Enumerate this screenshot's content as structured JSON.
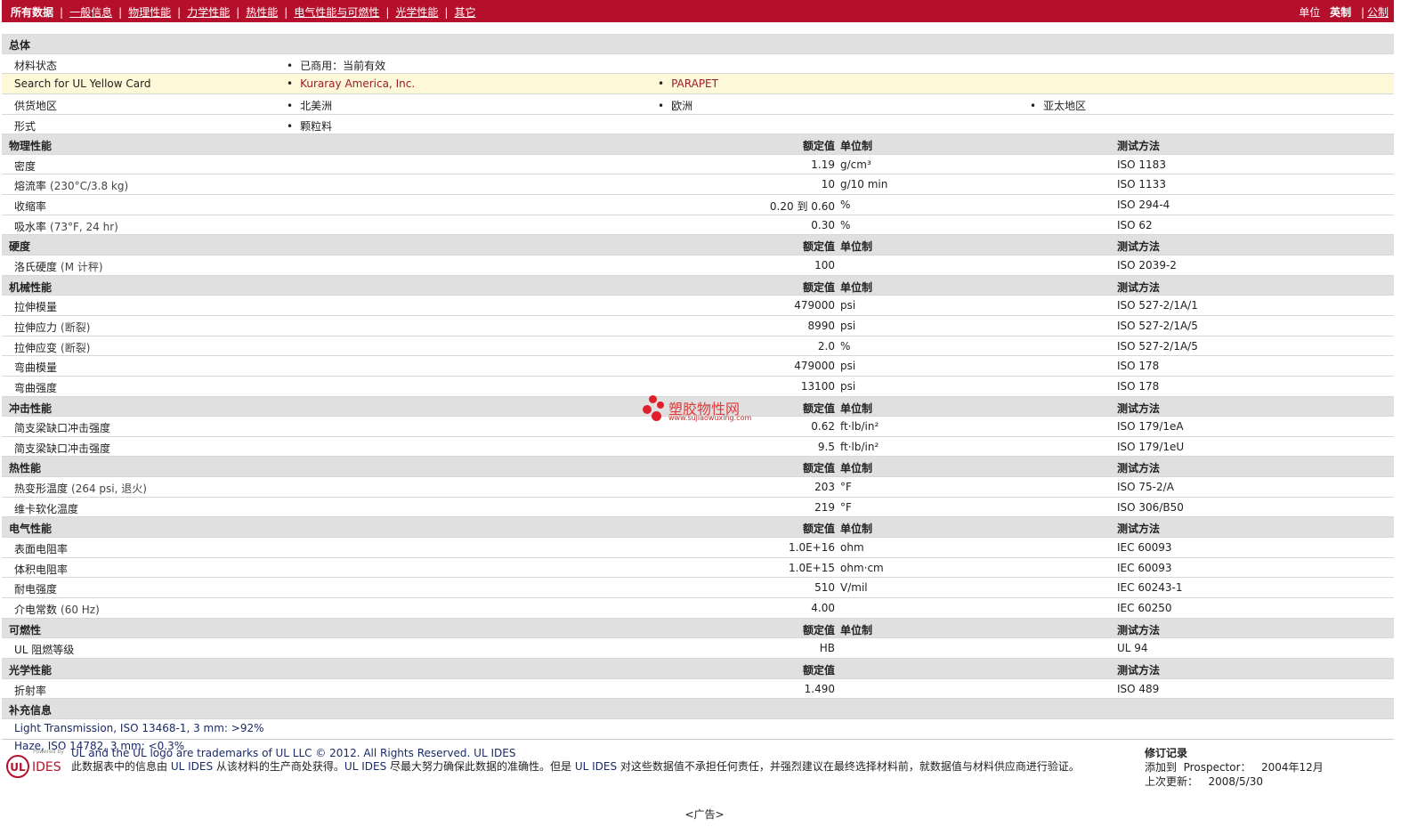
{
  "nav": {
    "items": [
      "所有数据",
      "一般信息",
      "物理性能",
      "力学性能",
      "热性能",
      "电气性能与可燃性",
      "光学性能",
      "其它"
    ],
    "units_label": "单位",
    "unit_english": "英制",
    "unit_metric": "公制"
  },
  "headers": {
    "nominal": "额定值",
    "unit": "单位制",
    "method": "测试方法"
  },
  "general": {
    "title": "总体",
    "status_label": "材料状态",
    "status_value": "已商用：当前有效",
    "ul_label": "Search for UL Yellow Card",
    "ul_v1": "Kuraray America, Inc.",
    "ul_v2": "PARAPET",
    "supply_label": "供货地区",
    "supply": [
      "北美洲",
      "欧洲",
      "亚太地区"
    ],
    "form_label": "形式",
    "form_value": "颗粒料"
  },
  "sections": [
    {
      "title": "物理性能",
      "show_unit": true,
      "rows": [
        {
          "label": "密度",
          "sub": "",
          "val": "1.19",
          "unit": "g/cm³",
          "method": "ISO 1183"
        },
        {
          "label": "熔流率",
          "sub": "(230°C/3.8 kg)",
          "val": "10",
          "unit": "g/10 min",
          "method": "ISO 1133"
        },
        {
          "label": "收缩率",
          "sub": "",
          "val": "0.20 到  0.60",
          "unit": "%",
          "method": "ISO 294-4"
        },
        {
          "label": "吸水率",
          "sub": "(73°F, 24 hr)",
          "val": "0.30",
          "unit": "%",
          "method": "ISO 62"
        }
      ]
    },
    {
      "title": "硬度",
      "show_unit": true,
      "rows": [
        {
          "label": "洛氏硬度",
          "sub": "(M 计秤)",
          "val": "100",
          "unit": "",
          "method": "ISO 2039-2"
        }
      ]
    },
    {
      "title": "机械性能",
      "show_unit": true,
      "rows": [
        {
          "label": "拉伸模量",
          "sub": "",
          "val": "479000",
          "unit": "psi",
          "method": "ISO 527-2/1A/1"
        },
        {
          "label": "拉伸应力",
          "sub": "(断裂)",
          "val": "8990",
          "unit": "psi",
          "method": "ISO 527-2/1A/5"
        },
        {
          "label": "拉伸应变",
          "sub": "(断裂)",
          "val": "2.0",
          "unit": "%",
          "method": "ISO 527-2/1A/5"
        },
        {
          "label": "弯曲模量",
          "sub": "",
          "val": "479000",
          "unit": "psi",
          "method": "ISO 178"
        },
        {
          "label": "弯曲强度",
          "sub": "",
          "val": "13100",
          "unit": "psi",
          "method": "ISO 178"
        }
      ]
    },
    {
      "title": "冲击性能",
      "show_unit": true,
      "rows": [
        {
          "label": "简支梁缺口冲击强度",
          "sub": "",
          "val": "0.62",
          "unit": "ft·lb/in²",
          "method": "ISO 179/1eA"
        },
        {
          "label": "简支梁缺口冲击强度",
          "sub": "",
          "val": "9.5",
          "unit": "ft·lb/in²",
          "method": "ISO 179/1eU"
        }
      ]
    },
    {
      "title": "热性能",
      "show_unit": true,
      "rows": [
        {
          "label": "热变形温度",
          "sub": "(264 psi, 退火)",
          "val": "203",
          "unit": "°F",
          "method": "ISO 75-2/A"
        },
        {
          "label": "维卡软化温度",
          "sub": "",
          "val": "219",
          "unit": "°F",
          "method": "ISO 306/B50"
        }
      ]
    },
    {
      "title": "电气性能",
      "show_unit": true,
      "rows": [
        {
          "label": "表面电阻率",
          "sub": "",
          "val": "1.0E+16",
          "unit": "ohm",
          "method": "IEC 60093"
        },
        {
          "label": "体积电阻率",
          "sub": "",
          "val": "1.0E+15",
          "unit": "ohm·cm",
          "method": "IEC 60093"
        },
        {
          "label": "耐电强度",
          "sub": "",
          "val": "510",
          "unit": "V/mil",
          "method": "IEC 60243-1"
        },
        {
          "label": "介电常数",
          "sub": "(60 Hz)",
          "val": "4.00",
          "unit": "",
          "method": "IEC 60250"
        }
      ]
    },
    {
      "title": "可燃性",
      "show_unit": true,
      "rows": [
        {
          "label": "UL 阻燃等级",
          "sub": "",
          "val": "HB",
          "unit": "",
          "method": "UL 94"
        }
      ]
    },
    {
      "title": "光学性能",
      "show_unit": false,
      "rows": [
        {
          "label": "折射率",
          "sub": "",
          "val": "1.490",
          "unit": "",
          "method": "ISO 489"
        }
      ]
    }
  ],
  "supplement": {
    "title": "补充信息",
    "lines": [
      "Light Transmission, ISO 13468-1, 3 mm: >92%",
      "Haze, ISO 14782, 3 mm: <0.3%"
    ]
  },
  "footer": {
    "logo_powered": "Powered by",
    "logo_ul": "UL",
    "logo_ides": "IDES",
    "trademark": "UL and the UL logo are trademarks of UL LLC © 2012. All Rights Reserved. UL IDES",
    "disclaimer_parts": [
      "此数据表中的信息由 ",
      "UL IDES",
      " 从该材料的生产商处获得。",
      "UL IDES",
      " 尽最大努力确保此数据的准确性。但是 ",
      "UL IDES",
      " 对这些数据值不承担任何责任，并强烈建议在最终选择材料前，就数据值与材料供应商进行验证。"
    ],
    "rev_title": "修订记录",
    "rev_added_label": "添加到",
    "rev_added_prospector": "Prospector：",
    "rev_added_date": "2004年12月",
    "rev_updated_label": "上次更新：",
    "rev_updated_date": "2008/5/30"
  },
  "watermark": {
    "name": "塑胶物性网",
    "url": "www.sujiaowuxing.com"
  },
  "ad_label": "<广告>"
}
